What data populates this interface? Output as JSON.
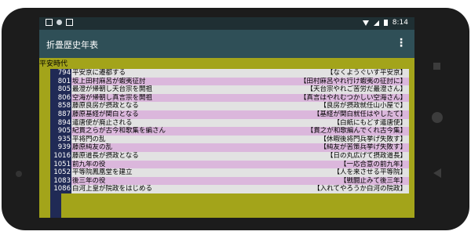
{
  "app": {
    "title": "折畳歴史年表"
  },
  "status": {
    "time": "8:14"
  },
  "era": "平安時代",
  "rows": [
    {
      "year": "794",
      "event": "平安京に遷都する",
      "mnemonic": "【なくようぐいす平安京】"
    },
    {
      "year": "801",
      "event": "坂上田村麻呂が蝦夷征討",
      "mnemonic": "【田村麻呂やれ行け蝦夷の征討に】"
    },
    {
      "year": "805",
      "event": "最澄が帰朝し天台宗を開祖",
      "mnemonic": "【天台宗やれご苦労だ最澄さん】"
    },
    {
      "year": "806",
      "event": "空海が帰朝し真言宗を開祖",
      "mnemonic": "【真言はやれむつかしい空海さん】"
    },
    {
      "year": "858",
      "event": "藤原良房が摂政となる",
      "mnemonic": "【良房が摂政就任山小屋で】"
    },
    {
      "year": "887",
      "event": "藤原基経が関白となる",
      "mnemonic": "【基経が関白就任はやしたて】"
    },
    {
      "year": "894",
      "event": "遣唐使が廃止される",
      "mnemonic": "【白紙にもどす遣唐使】"
    },
    {
      "year": "905",
      "event": "紀貫之らが古今和歌集を編さん",
      "mnemonic": "【貫之が和歌編んでくれ古今集】"
    },
    {
      "year": "935",
      "event": "平将門の乱",
      "mnemonic": "【休暇後将門兵挙げ失敗す】"
    },
    {
      "year": "939",
      "event": "藤原純友の乱",
      "mnemonic": "【純友が苦策兵挙げ失敗す】"
    },
    {
      "year": "1016",
      "event": "藤原道長が摂政となる",
      "mnemonic": "【日の丸広げて摂政道長】"
    },
    {
      "year": "1051",
      "event": "前九年の役",
      "mnemonic": "【一応合意の前九年】"
    },
    {
      "year": "1052",
      "event": "平等院鳳凰堂を建立",
      "mnemonic": "【人を来させる平等院】"
    },
    {
      "year": "1083",
      "event": "後三年の役",
      "mnemonic": "【戦闘止みて後三年】"
    },
    {
      "year": "1086",
      "event": "白河上皇が院政をはじめる",
      "mnemonic": "【入れてやろうか白河の院政】"
    }
  ]
}
